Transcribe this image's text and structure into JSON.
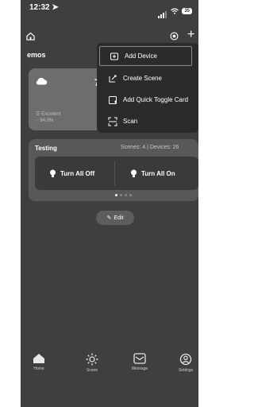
{
  "status": {
    "time": "12:32",
    "battery": "35"
  },
  "header": {
    "home_name": "emos"
  },
  "weather": {
    "temperature": "7",
    "condition": "Excellent",
    "humidity": "94.0%"
  },
  "menu": {
    "items": [
      {
        "label": "Add Device",
        "icon": "add-device-icon"
      },
      {
        "label": "Create Scene",
        "icon": "create-scene-icon"
      },
      {
        "label": "Add Quick Toggle Card",
        "icon": "quick-toggle-icon"
      },
      {
        "label": "Scan",
        "icon": "scan-icon"
      }
    ]
  },
  "testing": {
    "title": "Testing",
    "meta": "Scenes: 4  |  Devices: 26",
    "buttons": [
      {
        "label": "Turn All Off"
      },
      {
        "label": "Turn All On"
      }
    ]
  },
  "edit_label": "Edit",
  "nav": [
    {
      "label": "Home",
      "icon": "home-icon"
    },
    {
      "label": "Scene",
      "icon": "sun-icon"
    },
    {
      "label": "Message",
      "icon": "message-icon"
    },
    {
      "label": "Settings",
      "icon": "settings-icon"
    }
  ]
}
